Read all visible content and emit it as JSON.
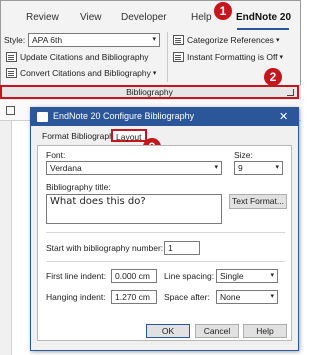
{
  "ribbon": {
    "tabs": [
      "Review",
      "View",
      "Developer",
      "Help",
      "EndNote 20"
    ],
    "style_label": "Style:",
    "style_value": "APA 6th",
    "buttons": {
      "update": "Update Citations and Bibliography",
      "convert": "Convert Citations and Bibliography",
      "categorize": "Categorize References",
      "instant": "Instant Formatting is Off"
    },
    "group_label": "Bibliography"
  },
  "badges": [
    "1",
    "2",
    "3"
  ],
  "dialog": {
    "title": "EndNote 20 Configure Bibliography",
    "close": "✕",
    "tabs": [
      "Format Bibliography",
      "Layout"
    ],
    "font_label": "Font:",
    "font_value": "Verdana",
    "size_label": "Size:",
    "size_value": "9",
    "bib_title_label": "Bibliography title:",
    "bib_title_value": "What does this do?",
    "text_format_button": "Text Format...",
    "start_label": "Start with bibliography number:",
    "start_value": "1",
    "first_indent_label": "First line indent:",
    "first_indent_value": "0.000 cm",
    "hanging_indent_label": "Hanging indent:",
    "hanging_indent_value": "1.270 cm",
    "line_spacing_label": "Line spacing:",
    "line_spacing_value": "Single",
    "space_after_label": "Space after:",
    "space_after_value": "None",
    "ok": "OK",
    "cancel": "Cancel",
    "help": "Help"
  },
  "colors": {
    "accent": "#2b579a",
    "highlight": "#c4161c"
  }
}
